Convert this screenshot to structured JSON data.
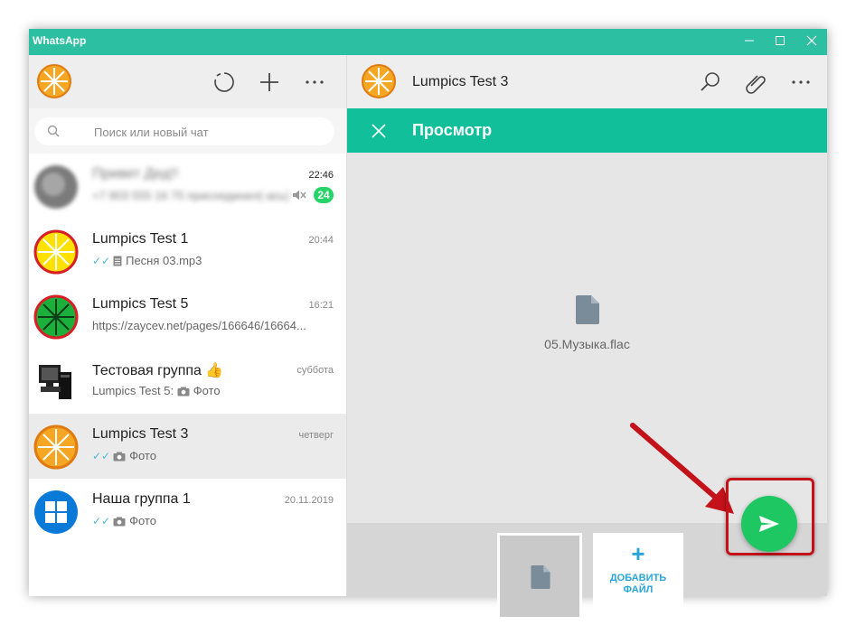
{
  "window": {
    "title": "WhatsApp",
    "accent": "#2cbfa1"
  },
  "sidebar": {
    "search": {
      "placeholder": "Поиск или новый чат"
    },
    "chats": [
      {
        "name": "Привет Дед!!",
        "time": "22:46",
        "preview": "+7 903 555 16 75 присоединил(-ась)",
        "unread": "24",
        "muted": true,
        "blurred": true
      },
      {
        "name": "Lumpics Test 1",
        "time": "20:44",
        "preview": "Песня 03.mp3"
      },
      {
        "name": "Lumpics Test 5",
        "time": "16:21",
        "preview": "https://zaycev.net/pages/166646/16664..."
      },
      {
        "name": "Тестовая группа 👍",
        "time": "суббота",
        "preview_sender": "Lumpics Test 5:",
        "preview": "Фото"
      },
      {
        "name": "Lumpics Test 3",
        "time": "четверг",
        "preview": "Фото",
        "active": true
      },
      {
        "name": "Наша группа 1",
        "time": "20.11.2019",
        "preview": "Фото"
      }
    ]
  },
  "chat": {
    "name": "Lumpics Test 3",
    "preview_title": "Просмотр",
    "file_name": "05.Музыка.flac",
    "add_file_line1": "ДОБАВИТЬ",
    "add_file_line2": "ФАЙЛ",
    "send_color": "#1ec762"
  }
}
